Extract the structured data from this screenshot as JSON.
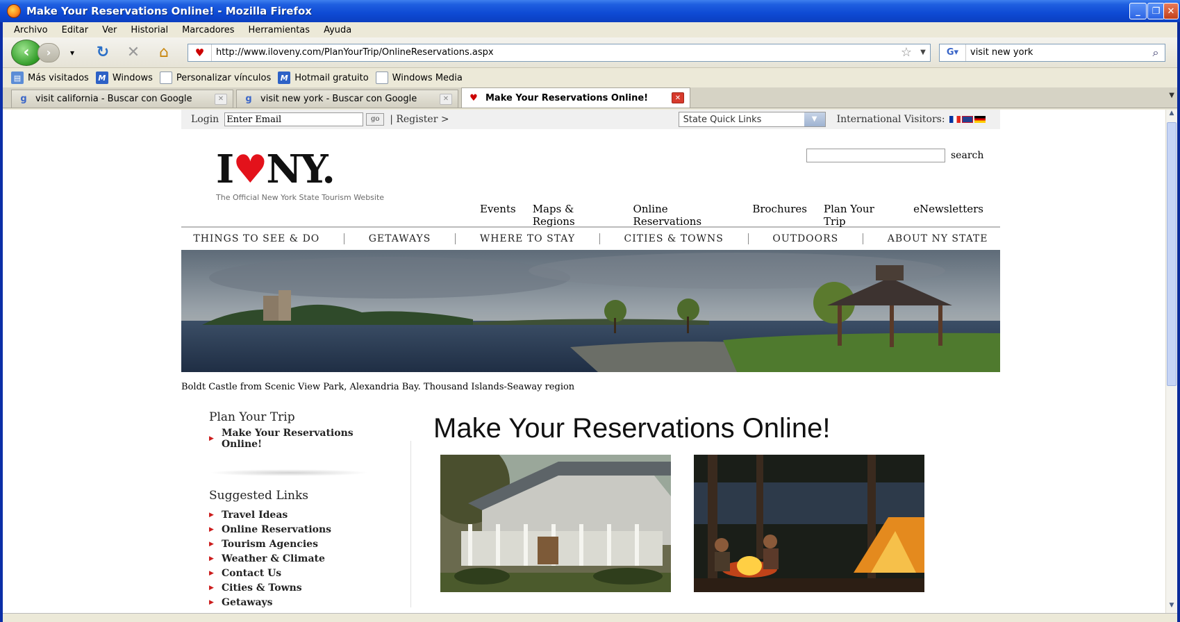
{
  "window": {
    "title": "Make Your Reservations Online! - Mozilla Firefox",
    "controls": [
      "minimize",
      "maximize",
      "close"
    ]
  },
  "menubar": [
    "Archivo",
    "Editar",
    "Ver",
    "Historial",
    "Marcadores",
    "Herramientas",
    "Ayuda"
  ],
  "navbar": {
    "url": "http://www.iloveny.com/PlanYourTrip/OnlineReservations.aspx",
    "search_value": "visit new york"
  },
  "bookmarks": [
    "Más visitados",
    "Windows",
    "Personalizar vínculos",
    "Hotmail gratuito",
    "Windows Media"
  ],
  "tabs": [
    {
      "label": "visit california - Buscar con Google",
      "active": false
    },
    {
      "label": "visit new york - Buscar con Google",
      "active": false
    },
    {
      "label": "Make Your Reservations Online!",
      "active": true
    }
  ],
  "page": {
    "utility": {
      "login_label": "Login",
      "email_value": "Enter Email",
      "go_label": "go",
      "register_label": "| Register >",
      "quick_links": "State Quick Links",
      "intl_label": "International Visitors:"
    },
    "logo_text_left": "I",
    "logo_text_right": "NY.",
    "tagline": "The Official New York State Tourism Website",
    "search_button": "search",
    "util_links": [
      "Events",
      "Maps & Regions",
      "Online Reservations",
      "Brochures",
      "Plan Your Trip",
      "eNewsletters"
    ],
    "main_nav": [
      "THINGS TO SEE & DO",
      "GETAWAYS",
      "WHERE TO STAY",
      "CITIES & TOWNS",
      "OUTDOORS",
      "ABOUT NY STATE"
    ],
    "caption": "Boldt Castle from Scenic View Park, Alexandria Bay. Thousand Islands-Seaway region",
    "left": {
      "heading": "Plan Your Trip",
      "sub_item": "Make Your Reservations Online!",
      "suggested_heading": "Suggested Links",
      "links": [
        "Travel Ideas",
        "Online Reservations",
        "Tourism Agencies",
        "Weather & Climate",
        "Contact Us",
        "Cities & Towns",
        "Getaways"
      ]
    },
    "title": "Make Your Reservations Online!"
  }
}
